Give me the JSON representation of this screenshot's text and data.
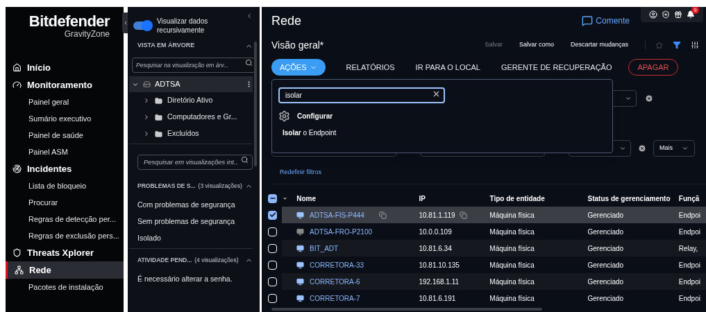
{
  "brand": {
    "name": "Bitdefender",
    "product": "GravityZone"
  },
  "nav": [
    {
      "label": "Início",
      "kind": "section",
      "selected": false
    },
    {
      "label": "Monitoramento",
      "kind": "section",
      "selected": false
    },
    {
      "label": "Painel geral",
      "kind": "link",
      "selected": false
    },
    {
      "label": "Sumário executivo",
      "kind": "link",
      "selected": false
    },
    {
      "label": "Painel de saúde",
      "kind": "link",
      "selected": false
    },
    {
      "label": "Painel ASM",
      "kind": "link",
      "selected": false
    },
    {
      "label": "Incidentes",
      "kind": "section",
      "selected": false
    },
    {
      "label": "Lista de bloqueio",
      "kind": "link",
      "selected": false
    },
    {
      "label": "Procurar",
      "kind": "link",
      "selected": false
    },
    {
      "label": "Regras de detecção per...",
      "kind": "link",
      "selected": false
    },
    {
      "label": "Regras de exclusão pers...",
      "kind": "link",
      "selected": false
    },
    {
      "label": "Threats Xplorer",
      "kind": "section",
      "selected": false
    },
    {
      "label": "Rede",
      "kind": "section",
      "selected": true
    },
    {
      "label": "Pacotes de instalação",
      "kind": "link",
      "selected": false
    }
  ],
  "panel": {
    "toggle": {
      "label": "Visualizar dados recursivamente",
      "on": true
    },
    "tree_title": "VISTA EM ÁRVORE",
    "tree_search": {
      "placeholder": "Pesquisar na visualização em árv..."
    },
    "tree": [
      {
        "label": "ADTSA",
        "expanded": true,
        "children": [
          {
            "label": "Diretório Ativo",
            "expanded": false
          },
          {
            "label": "Computadores e Gr...",
            "expanded": false
          },
          {
            "label": "Excluídos",
            "expanded": false
          }
        ]
      }
    ],
    "views_search": {
      "placeholder": "Pesquisar em visualizações int..."
    },
    "groups": [
      {
        "title": "PROBLEMAS DE S...",
        "count": "(3 visualizações)",
        "expanded": true,
        "items": [
          "Com problemas de segurança",
          "Sem problemas de segurança",
          "Isolado"
        ]
      },
      {
        "title": "ATIVIDADE PEND...",
        "count": "(4 visualizações)",
        "expanded": true,
        "items": [
          "É necessário alterar a senha."
        ]
      }
    ]
  },
  "header": {
    "title": "Rede",
    "comment": "Comente",
    "notifications": "9"
  },
  "view": {
    "title": "Visão geral*",
    "actions": [
      {
        "label": "Salvar",
        "disabled": true
      },
      {
        "label": "Salvar como",
        "disabled": false
      },
      {
        "label": "Descartar mudanças",
        "disabled": false
      }
    ]
  },
  "toolbar": [
    {
      "label": "AÇÕES",
      "kind": "primary"
    },
    {
      "label": "RELATÓRIOS",
      "kind": "text"
    },
    {
      "label": "IR PARA O LOCAL",
      "kind": "text"
    },
    {
      "label": "GERENTE DE RECUPERAÇÃO",
      "kind": "text"
    },
    {
      "label": "APAGAR",
      "kind": "danger"
    }
  ],
  "actions_menu": {
    "search": "isolar",
    "items": [
      {
        "label": "Configurar",
        "kind": "group"
      },
      {
        "label": "**Isolar** o Endpoint",
        "kind": "item"
      }
    ]
  },
  "filters": {
    "more": "Mais",
    "reset": "Redefinir filtros"
  },
  "table": {
    "select_all_mixed": true,
    "columns": [
      "Nome",
      "IP",
      "Tipo de entidade",
      "Status de gerenciamento",
      "Funçã"
    ],
    "rows": [
      {
        "checked": true,
        "online": true,
        "name": "ADTSA-FIS-P444",
        "ip": "10.81.1.119",
        "type": "Máquina física",
        "status": "Gerenciado",
        "column_5": "Endpoi"
      },
      {
        "checked": false,
        "online": false,
        "name": "ADTSA-FRO-P2100",
        "ip": "10.0.0.109",
        "type": "Máquina física",
        "status": "Gerenciado",
        "column_5": "Endpoi"
      },
      {
        "checked": false,
        "online": true,
        "name": "BIT_ADT",
        "ip": "10.81.6.34",
        "type": "Máquina física",
        "status": "Gerenciado",
        "column_5": "Relay,"
      },
      {
        "checked": false,
        "online": true,
        "name": "CORRETORA-33",
        "ip": "10.81.10.135",
        "type": "Máquina física",
        "status": "Gerenciado",
        "column_5": "Endpoi"
      },
      {
        "checked": false,
        "online": true,
        "name": "CORRETORA-6",
        "ip": "192.168.1.11",
        "type": "Máquina física",
        "status": "Gerenciado",
        "column_5": "Endpoi"
      },
      {
        "checked": false,
        "online": true,
        "name": "CORRETORA-7",
        "ip": "10.81.6.191",
        "type": "Máquina física",
        "status": "Gerenciado",
        "column_5": "Endpoi"
      }
    ]
  }
}
